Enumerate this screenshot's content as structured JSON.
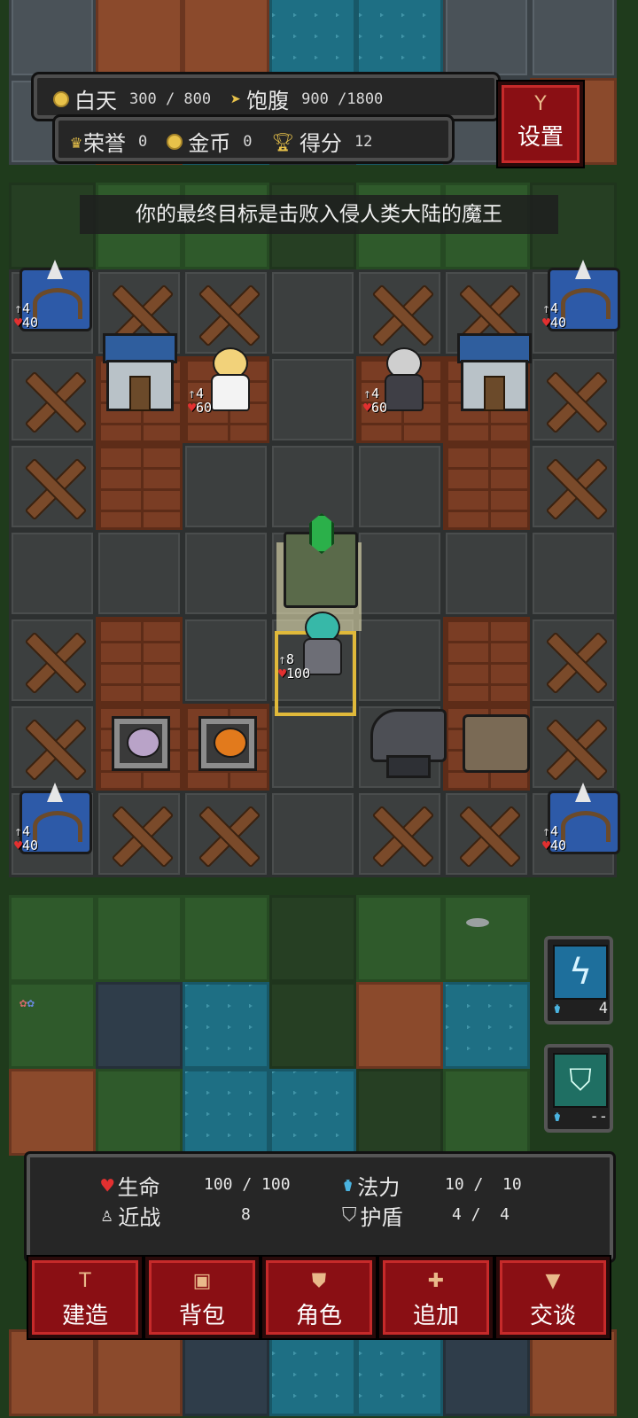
{
  "hud": {
    "day_label": "白天",
    "day_value": "300 / 800",
    "hunger_label": "饱腹",
    "hunger_value": "900 /1800",
    "honor_label": "荣誉",
    "honor_value": "0",
    "gold_label": "金币",
    "gold_value": "0",
    "score_label": "得分",
    "score_value": "12",
    "settings_label": "设置",
    "icons": {
      "day": "coin-icon",
      "hunger": "bolt-icon",
      "honor": "crown-icon",
      "gold": "coin-icon",
      "score": "trophy-icon",
      "settings": "shovel-icon"
    }
  },
  "banner": "你的最终目标是击败入侵人类大陆的魔王",
  "units": {
    "tower_atk": "4",
    "tower_hp": "40",
    "angel_atk": "4",
    "angel_hp": "60",
    "elder_atk": "4",
    "elder_hp": "60",
    "hero_atk": "8",
    "hero_hp": "100"
  },
  "skills": [
    {
      "name": "lightning-skill",
      "cost": "4"
    },
    {
      "name": "shield-skill",
      "cost": "--"
    }
  ],
  "stats": {
    "hp_label": "生命",
    "hp_value": "100 / 100",
    "mana_label": "法力",
    "mana_value": "10 /  10",
    "melee_label": "近战",
    "melee_value": "8",
    "shield_label": "护盾",
    "shield_value": "4 /  4"
  },
  "actions": {
    "build": "建造",
    "bag": "背包",
    "character": "角色",
    "add": "追加",
    "talk": "交谈"
  },
  "colors": {
    "accent_red": "#8a0f14",
    "hp_red": "#e23030",
    "mana_blue": "#4ab3e0",
    "gold": "#e8c24a"
  }
}
